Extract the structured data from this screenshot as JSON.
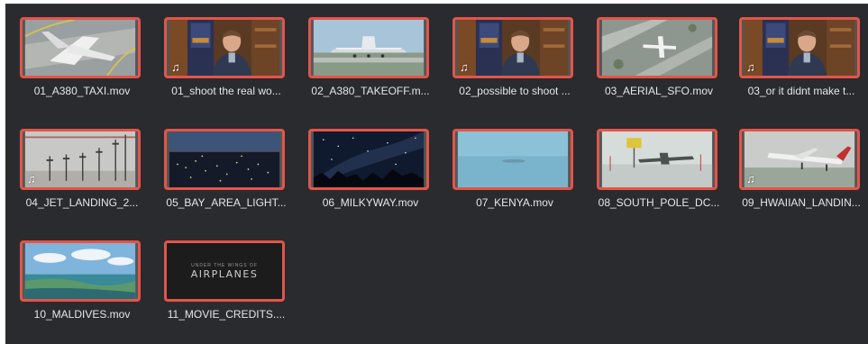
{
  "clips": [
    {
      "label": "01_A380_TAXI.mov",
      "audio": false
    },
    {
      "label": "01_shoot the real wo...",
      "audio": true
    },
    {
      "label": "02_A380_TAKEOFF.m...",
      "audio": false
    },
    {
      "label": "02_possible to shoot ...",
      "audio": true
    },
    {
      "label": "03_AERIAL_SFO.mov",
      "audio": false
    },
    {
      "label": "03_or it didnt make t...",
      "audio": true
    },
    {
      "label": "04_JET_LANDING_2...",
      "audio": true
    },
    {
      "label": "05_BAY_AREA_LIGHT...",
      "audio": false
    },
    {
      "label": "06_MILKYWAY.mov",
      "audio": false
    },
    {
      "label": "07_KENYA.mov",
      "audio": false
    },
    {
      "label": "08_SOUTH_POLE_DC...",
      "audio": false
    },
    {
      "label": "09_HWAIIAN_LANDIN...",
      "audio": true
    },
    {
      "label": "10_MALDIVES.mov",
      "audio": false
    },
    {
      "label": "11_MOVIE_CREDITS....",
      "audio": false
    }
  ],
  "audio_icon": "music-note-icon",
  "audio_glyph": "♫",
  "credits_thumb": {
    "small_text": "UNDER THE WINGS OF",
    "title": "AIRPLANES"
  },
  "colors": {
    "background": "#2a2b2f",
    "selection_border": "#e2554a",
    "label_text": "#e6e6e6"
  }
}
